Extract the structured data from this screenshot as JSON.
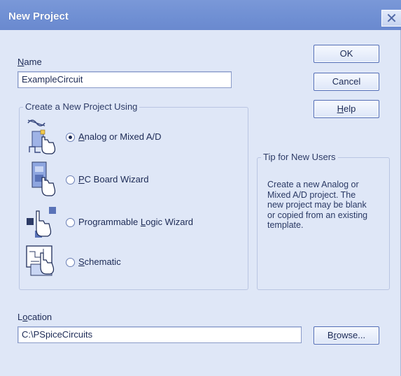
{
  "window": {
    "title": "New Project",
    "close_glyph": "✕"
  },
  "name_field": {
    "label": "ame",
    "label_mnemonic": "N",
    "value": "ExampleCircuit"
  },
  "buttons": {
    "ok": "OK",
    "cancel": "Cancel",
    "help_mnemonic": "H",
    "help_rest": "elp",
    "browse_prefix": "B",
    "browse_mnemonic": "r",
    "browse_rest": "owse..."
  },
  "project_types": {
    "group_title": "Create a New Project Using",
    "options": [
      {
        "mnemonic": "A",
        "rest": "nalog or Mixed A/D",
        "selected": true,
        "icon": "analog-icon"
      },
      {
        "mnemonic": "P",
        "rest": "C Board Wizard",
        "selected": false,
        "icon": "pcb-wizard-icon"
      },
      {
        "prefix": "Programmable ",
        "mnemonic": "L",
        "rest": "ogic Wizard",
        "selected": false,
        "icon": "logic-wizard-icon"
      },
      {
        "mnemonic": "S",
        "rest": "chematic",
        "selected": false,
        "icon": "schematic-icon"
      }
    ]
  },
  "tip": {
    "title": "Tip for New Users",
    "lines": [
      "Create a new Analog or",
      "Mixed A/D project.  The",
      "new project may be blank",
      "or copied from an existing",
      "template."
    ]
  },
  "location_field": {
    "label_prefix": "L",
    "label_mnemonic": "o",
    "label_rest": "cation",
    "value": "C:\\PSpiceCircuits"
  },
  "colors": {
    "title_bar": "#6f8fd3",
    "dialog_bg": "#dfe7f7",
    "button_border": "#4e6ab5"
  }
}
